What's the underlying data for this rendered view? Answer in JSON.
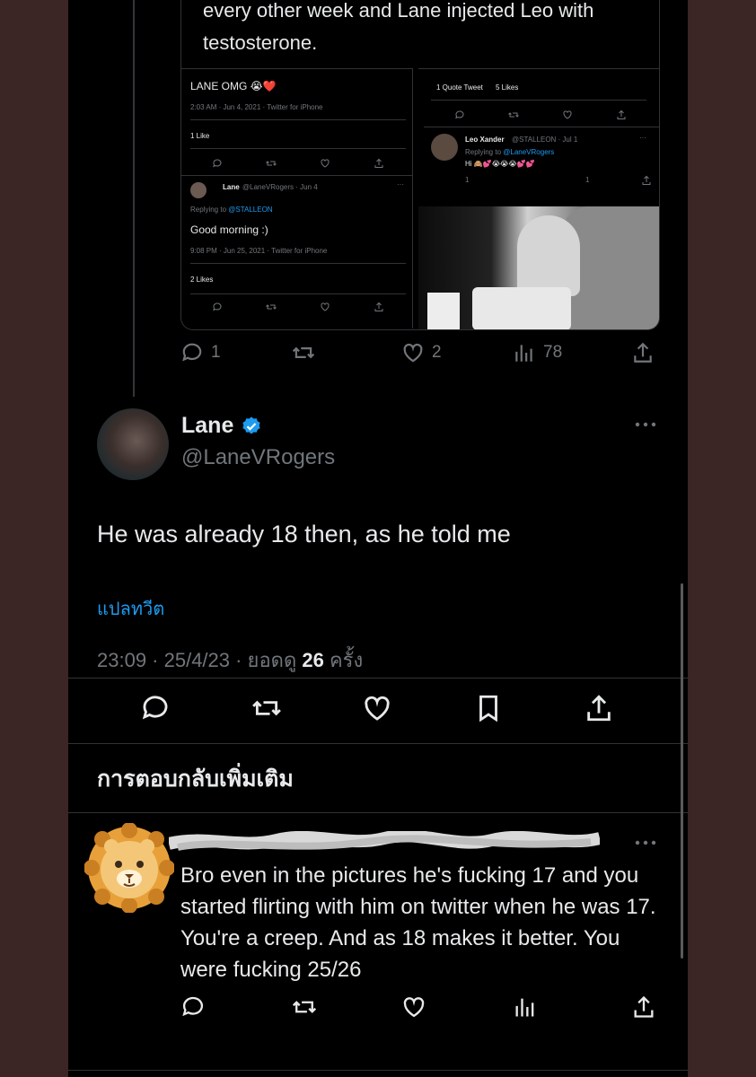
{
  "quoted_screenshot": {
    "visible_text": "every other week and Lane injected Leo with testosterone.",
    "left_panel": {
      "tweet_text": "LANE OMG 😭❤️",
      "timestamp": "2:03 AM · Jun 4, 2021 · Twitter for iPhone",
      "likes": "1 Like",
      "reply_author": "Lane",
      "reply_handle_date": "@LaneVRogers · Jun 4",
      "replying_to_prefix": "Replying to",
      "replying_to_handle": "@STALLEON",
      "reply_text": "Good morning :)",
      "reply_timestamp": "9:08 PM · Jun 25, 2021 · Twitter for iPhone",
      "reply_likes": "2 Likes"
    },
    "right_panel": {
      "quote_tweets": "1 Quote Tweet",
      "likes": "5 Likes",
      "author": "Leo Xander",
      "handle_date": "@STALLEON · Jul 1",
      "replying_to_prefix": "Replying to",
      "replying_to_handle": "@LaneVRogers",
      "reply_text": "Hi 🙈💕😭😭😭💕💕",
      "reply_count": "1",
      "like_count": "1"
    }
  },
  "parent_actions": {
    "replies": "1",
    "likes": "2",
    "views": "78"
  },
  "main_tweet": {
    "display_name": "Lane",
    "handle": "@LaneVRogers",
    "text": "He was already 18 then, as he told me",
    "translate_label": "แปลทวีต",
    "time_date": "23:09 · 25/4/23 · ยอดดู ",
    "views_count": "26",
    "views_suffix": " ครั้ง"
  },
  "more_replies_heading": "การตอบกลับเพิ่มเติม",
  "reply": {
    "text": "Bro even in the pictures he's fucking 17 and you started flirting with him on twitter when he was 17. You're a creep. And as 18 makes it better. You were fucking 25/26"
  },
  "colors": {
    "background": "#000000",
    "frame": "#3c2525",
    "text": "#e7e9ea",
    "secondary": "#71767b",
    "accent": "#1d9bf0"
  }
}
